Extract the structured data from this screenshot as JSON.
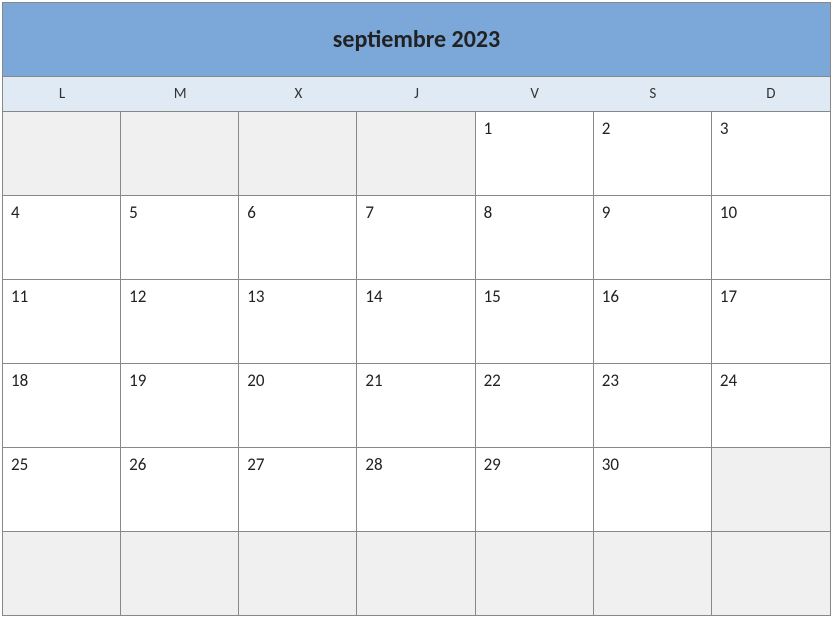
{
  "title": "septiembre 2023",
  "dayHeaders": [
    "L",
    "M",
    "X",
    "J",
    "V",
    "S",
    "D"
  ],
  "weeks": [
    [
      "",
      "",
      "",
      "",
      "1",
      "2",
      "3"
    ],
    [
      "4",
      "5",
      "6",
      "7",
      "8",
      "9",
      "10"
    ],
    [
      "11",
      "12",
      "13",
      "14",
      "15",
      "16",
      "17"
    ],
    [
      "18",
      "19",
      "20",
      "21",
      "22",
      "23",
      "24"
    ],
    [
      "25",
      "26",
      "27",
      "28",
      "29",
      "30",
      ""
    ],
    [
      "",
      "",
      "",
      "",
      "",
      "",
      ""
    ]
  ]
}
